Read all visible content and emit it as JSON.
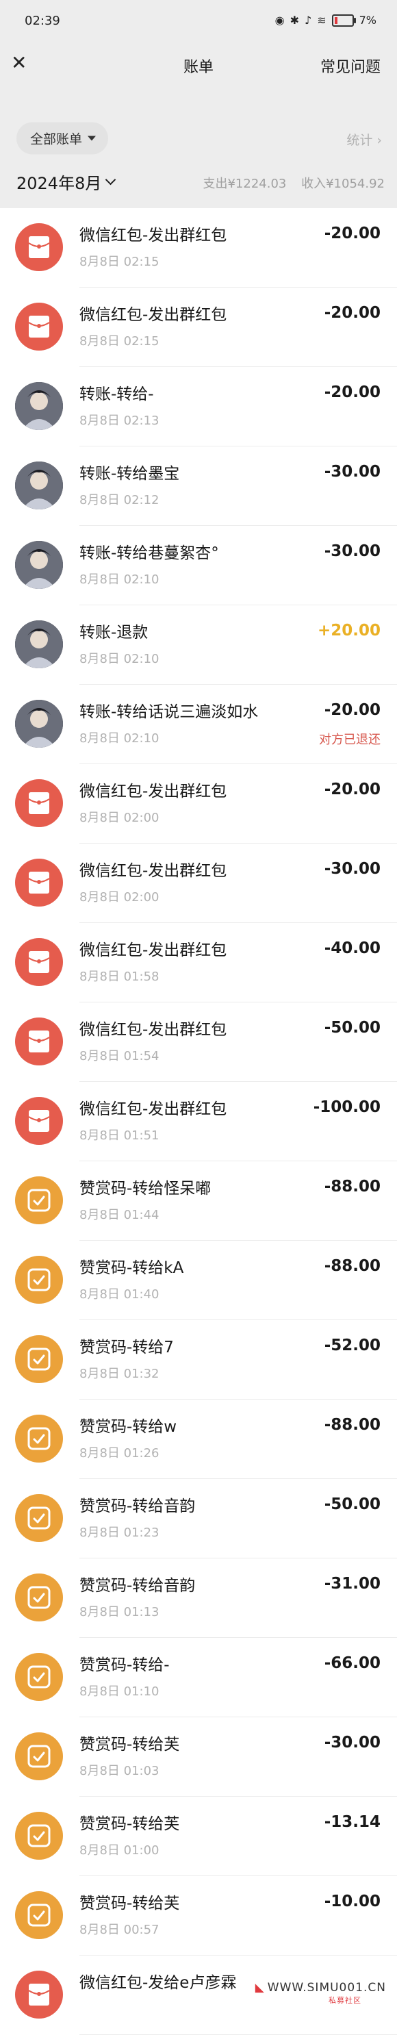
{
  "status": {
    "time": "02:39",
    "battery": "7%"
  },
  "nav": {
    "title": "账单",
    "help": "常见问题"
  },
  "filter": {
    "label": "全部账单",
    "stats": "统计"
  },
  "month": {
    "label": "2024年8月",
    "expense": "支出¥1224.03",
    "income": "收入¥1054.92"
  },
  "transactions": [
    {
      "icon": "redpacket",
      "name": "微信红包-发出群红包",
      "time": "8月8日 02:15",
      "amount": "-20.00",
      "note": ""
    },
    {
      "icon": "redpacket",
      "name": "微信红包-发出群红包",
      "time": "8月8日 02:15",
      "amount": "-20.00",
      "note": ""
    },
    {
      "icon": "photo",
      "name": "转账-转给-",
      "time": "8月8日 02:13",
      "amount": "-20.00",
      "note": ""
    },
    {
      "icon": "photo",
      "name": "转账-转给墨宝",
      "time": "8月8日 02:12",
      "amount": "-30.00",
      "note": ""
    },
    {
      "icon": "photo",
      "name": "转账-转给巷蔓絮杏°",
      "time": "8月8日 02:10",
      "amount": "-30.00",
      "note": ""
    },
    {
      "icon": "photo",
      "name": "转账-退款",
      "time": "8月8日 02:10",
      "amount": "+20.00",
      "note": ""
    },
    {
      "icon": "photo",
      "name": "转账-转给话说三遍淡如水",
      "time": "8月8日 02:10",
      "amount": "-20.00",
      "note": "对方已退还"
    },
    {
      "icon": "redpacket",
      "name": "微信红包-发出群红包",
      "time": "8月8日 02:00",
      "amount": "-20.00",
      "note": ""
    },
    {
      "icon": "redpacket",
      "name": "微信红包-发出群红包",
      "time": "8月8日 02:00",
      "amount": "-30.00",
      "note": ""
    },
    {
      "icon": "redpacket",
      "name": "微信红包-发出群红包",
      "time": "8月8日 01:58",
      "amount": "-40.00",
      "note": ""
    },
    {
      "icon": "redpacket",
      "name": "微信红包-发出群红包",
      "time": "8月8日 01:54",
      "amount": "-50.00",
      "note": ""
    },
    {
      "icon": "redpacket",
      "name": "微信红包-发出群红包",
      "time": "8月8日 01:51",
      "amount": "-100.00",
      "note": ""
    },
    {
      "icon": "appreciate",
      "name": "赞赏码-转给怪呆嘟",
      "time": "8月8日 01:44",
      "amount": "-88.00",
      "note": ""
    },
    {
      "icon": "appreciate",
      "name": "赞赏码-转给kA",
      "time": "8月8日 01:40",
      "amount": "-88.00",
      "note": ""
    },
    {
      "icon": "appreciate",
      "name": "赞赏码-转给7",
      "time": "8月8日 01:32",
      "amount": "-52.00",
      "note": ""
    },
    {
      "icon": "appreciate",
      "name": "赞赏码-转给w",
      "time": "8月8日 01:26",
      "amount": "-88.00",
      "note": ""
    },
    {
      "icon": "appreciate",
      "name": "赞赏码-转给音韵",
      "time": "8月8日 01:23",
      "amount": "-50.00",
      "note": ""
    },
    {
      "icon": "appreciate",
      "name": "赞赏码-转给音韵",
      "time": "8月8日 01:13",
      "amount": "-31.00",
      "note": ""
    },
    {
      "icon": "appreciate",
      "name": "赞赏码-转给-",
      "time": "8月8日 01:10",
      "amount": "-66.00",
      "note": ""
    },
    {
      "icon": "appreciate",
      "name": "赞赏码-转给芙",
      "time": "8月8日 01:03",
      "amount": "-30.00",
      "note": ""
    },
    {
      "icon": "appreciate",
      "name": "赞赏码-转给芙",
      "time": "8月8日 01:00",
      "amount": "-13.14",
      "note": ""
    },
    {
      "icon": "appreciate",
      "name": "赞赏码-转给芙",
      "time": "8月8日 00:57",
      "amount": "-10.00",
      "note": ""
    },
    {
      "icon": "redpacket",
      "name": "微信红包-发给e卢彦霖",
      "time": "",
      "amount": "",
      "note": ""
    }
  ],
  "watermark": {
    "site": "WWW.SIMU001.CN",
    "sub": "私募社区"
  }
}
